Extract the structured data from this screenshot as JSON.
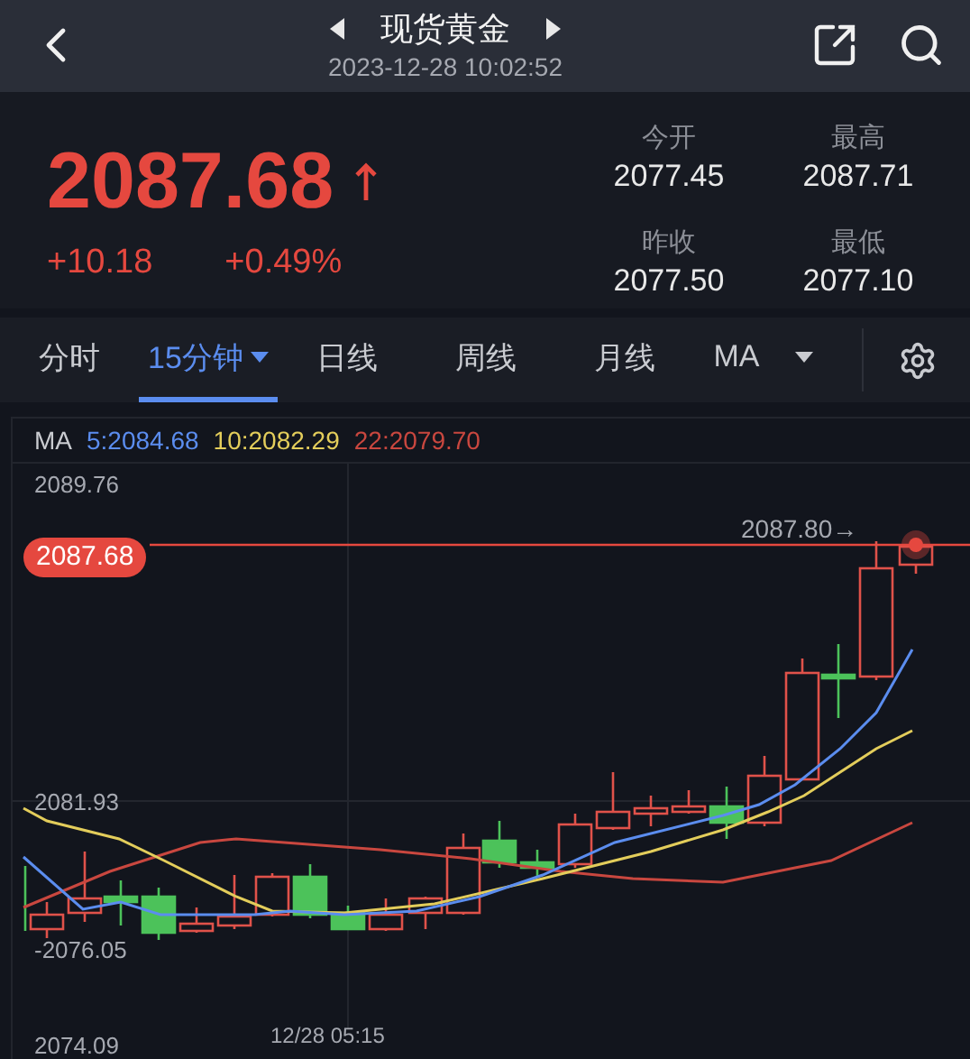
{
  "header": {
    "title": "现货黄金",
    "timestamp": "2023-12-28 10:02:52"
  },
  "quote": {
    "price": "2087.68",
    "change": "+10.18",
    "change_percent": "+0.49%",
    "stats": [
      {
        "label": "今开",
        "value": "2077.45"
      },
      {
        "label": "最高",
        "value": "2087.71"
      },
      {
        "label": "昨收",
        "value": "2077.50"
      },
      {
        "label": "最低",
        "value": "2077.10"
      }
    ]
  },
  "tabs": [
    {
      "label": "分时",
      "selected": false,
      "dropdown": false
    },
    {
      "label": "15分钟",
      "selected": true,
      "dropdown": true
    },
    {
      "label": "日线",
      "selected": false,
      "dropdown": false
    },
    {
      "label": "周线",
      "selected": false,
      "dropdown": false
    },
    {
      "label": "月线",
      "selected": false,
      "dropdown": false
    },
    {
      "label": "MA",
      "selected": false,
      "dropdown": true
    }
  ],
  "chart": {
    "legend": {
      "label": "MA",
      "items": [
        {
          "text": "5:2084.68",
          "color": "#5b8def"
        },
        {
          "text": "10:2082.29",
          "color": "#e3cd5b"
        },
        {
          "text": "22:2079.70",
          "color": "#c9473f"
        }
      ]
    },
    "price_labels": [
      "2089.76",
      "2081.93",
      "-2076.05",
      "2074.09"
    ],
    "current_price": "2087.68",
    "last_marker": "2087.80→",
    "time_label": "12/28 05:15"
  }
}
